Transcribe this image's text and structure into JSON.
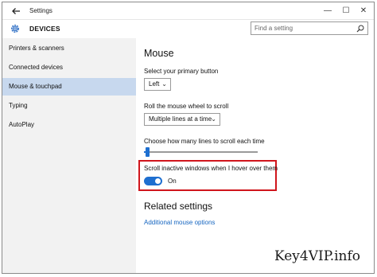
{
  "window": {
    "title": "Settings",
    "controls": {
      "minimize": "—",
      "maximize": "☐",
      "close": "✕"
    }
  },
  "header": {
    "section": "DEVICES",
    "search_placeholder": "Find a setting"
  },
  "sidebar": {
    "items": [
      {
        "label": "Printers & scanners",
        "selected": false
      },
      {
        "label": "Connected devices",
        "selected": false
      },
      {
        "label": "Mouse & touchpad",
        "selected": true
      },
      {
        "label": "Typing",
        "selected": false
      },
      {
        "label": "AutoPlay",
        "selected": false
      }
    ]
  },
  "main": {
    "heading": "Mouse",
    "primary_button": {
      "label": "Select your primary button",
      "value": "Left"
    },
    "wheel": {
      "label": "Roll the mouse wheel to scroll",
      "value": "Multiple lines at a time"
    },
    "lines": {
      "label": "Choose how many lines to scroll each time",
      "fraction": 0.03
    },
    "inactive_scroll": {
      "label": "Scroll inactive windows when I hover over them",
      "state": "On",
      "on": true
    },
    "related": {
      "heading": "Related settings",
      "link": "Additional mouse options"
    }
  },
  "watermark": "Key4VIP.info",
  "colors": {
    "accent": "#1e6fd0",
    "selected_nav": "#c7d8ee",
    "sidebar_bg": "#f2f2f2",
    "highlight": "#d0151c",
    "link": "#1565c0"
  }
}
